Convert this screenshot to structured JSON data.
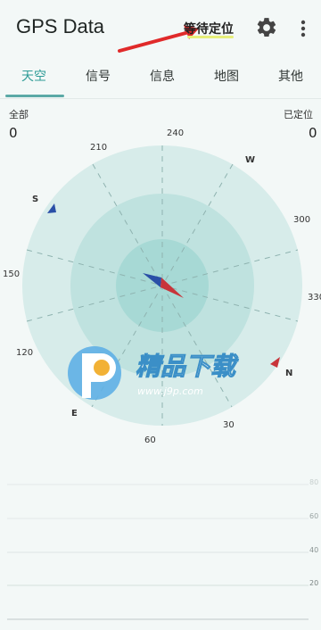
{
  "appbar": {
    "title": "GPS Data",
    "status": "等待定位"
  },
  "tabs": [
    {
      "label": "天空"
    },
    {
      "label": "信号"
    },
    {
      "label": "信息"
    },
    {
      "label": "地图"
    },
    {
      "label": "其他"
    }
  ],
  "counts": {
    "all_label": "全部",
    "all_value": "0",
    "fixed_label": "已定位",
    "fixed_value": "0"
  },
  "sky": {
    "azimuth_labels": [
      "240",
      "210",
      "W",
      "300",
      "S",
      "150",
      "330",
      "120",
      "N",
      "E",
      "30",
      "60"
    ]
  },
  "watermark": {
    "title": "精品下载",
    "url": "www.j9p.com"
  },
  "plot": {
    "y_ticks": [
      "80",
      "60",
      "40",
      "20"
    ]
  },
  "colors": {
    "accent": "#2f9c97",
    "compass_red": "#c8343a",
    "compass_blue": "#2a4fa7"
  }
}
